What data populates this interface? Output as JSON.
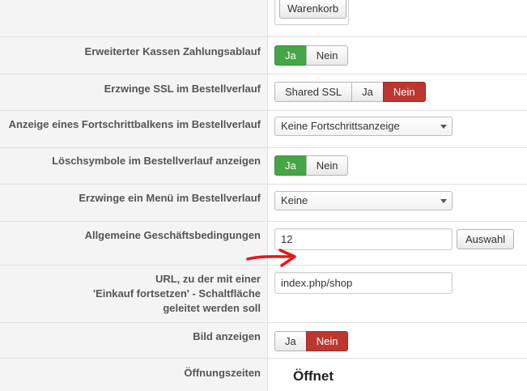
{
  "cart": {
    "label": "Warenkorb"
  },
  "rows": [
    {
      "label": "Erweiterter Kassen Zahlungsablauf",
      "options": [
        "Ja",
        "Nein"
      ],
      "selected": "Ja"
    },
    {
      "label": "Erzwinge SSL im Bestellverlauf",
      "options": [
        "Shared SSL",
        "Ja",
        "Nein"
      ],
      "selected": "Nein"
    },
    {
      "label": "Anzeige eines Fortschrittbalkens im Bestellverlauf",
      "value": "Keine Fortschrittsanzeige"
    },
    {
      "label": "Löschsymbole im Bestellverlauf anzeigen",
      "options": [
        "Ja",
        "Nein"
      ],
      "selected": "Ja"
    },
    {
      "label": "Erzwinge ein Menü im Bestellverlauf",
      "value": "Keine"
    },
    {
      "label": "Allgemeine Geschäftsbedingungen",
      "value": "12",
      "button": "Auswahl"
    },
    {
      "label_lines": [
        "URL, zu der mit einer",
        "'Einkauf fortsetzen' - Schaltfläche",
        "geleitet werden soll"
      ],
      "value": "index.php/shop"
    },
    {
      "label": "Bild anzeigen",
      "options": [
        "Ja",
        "Nein"
      ],
      "selected": "Nein"
    },
    {
      "label": "Öffnungszeiten",
      "value": "Öffnet"
    }
  ],
  "colors": {
    "yes": "#46a546",
    "no": "#bd362f",
    "arrow": "#e8141b"
  }
}
